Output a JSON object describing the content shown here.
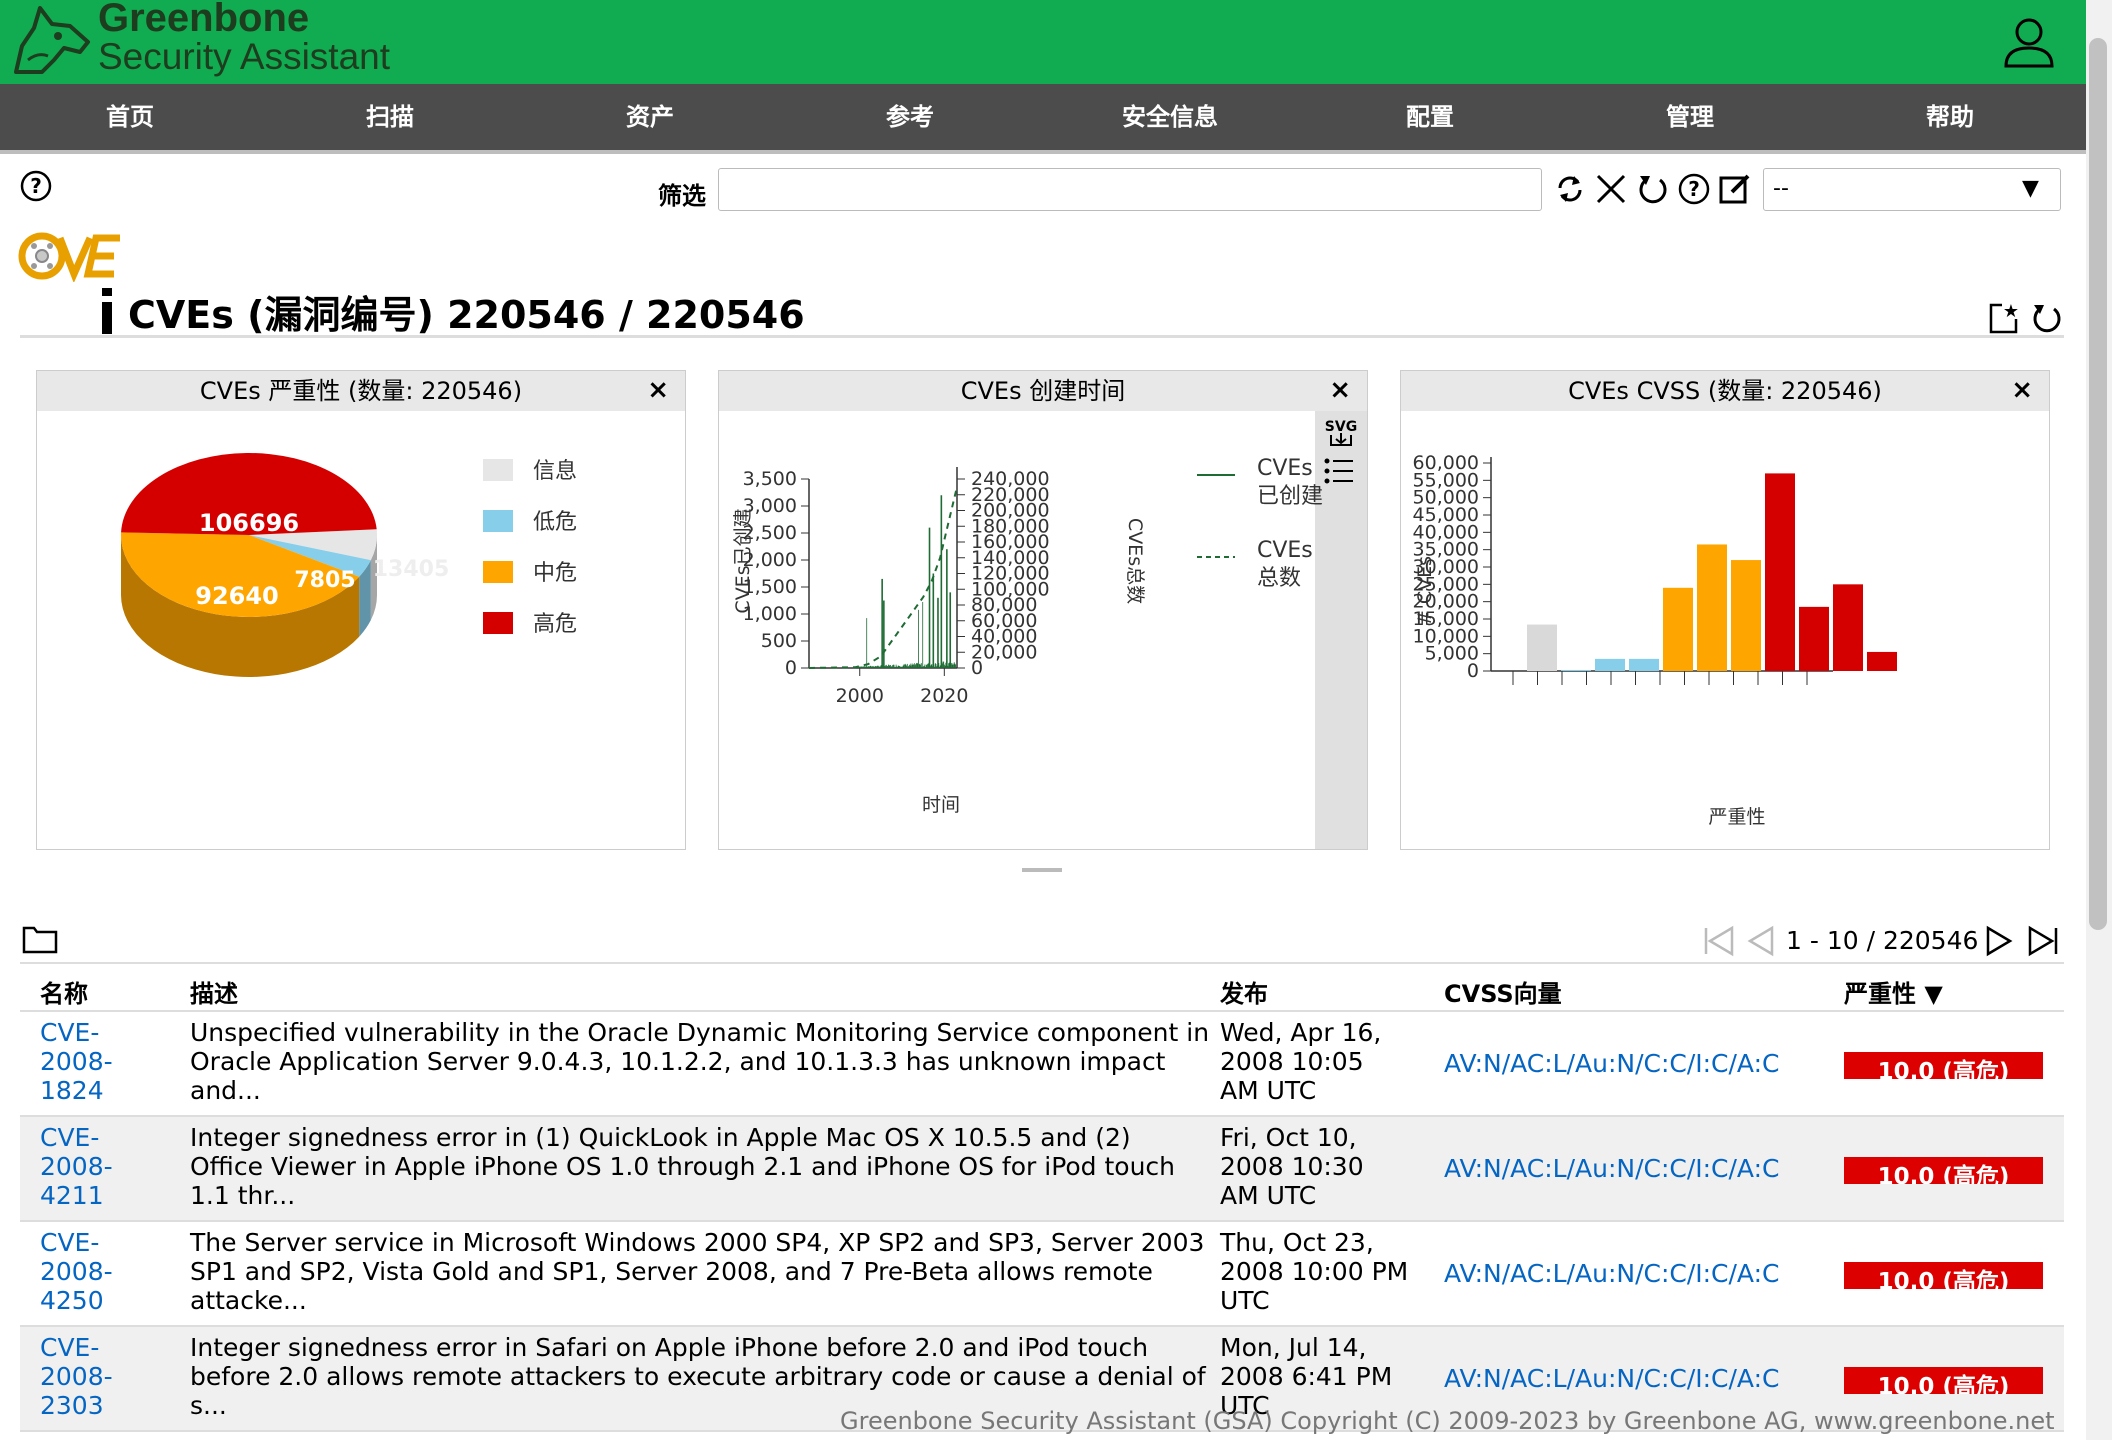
{
  "header": {
    "brand_line1": "Greenbone",
    "brand_line2": "Security Assistant"
  },
  "nav": [
    "首页",
    "扫描",
    "资产",
    "参考",
    "安全信息",
    "配置",
    "管理",
    "帮助"
  ],
  "filter": {
    "label": "筛选",
    "value": "",
    "select_value": "--"
  },
  "page": {
    "title": "CVEs (漏洞编号) 220546 / 220546"
  },
  "panels": {
    "severity": {
      "title": "CVEs 严重性 (数量: 220546)",
      "legend": [
        "信息",
        "低危",
        "中危",
        "高危"
      ],
      "labels": [
        "106696",
        "92640",
        "7805",
        "13405"
      ],
      "values": [
        {
          "label": "信息",
          "count": 13405
        },
        {
          "label": "低危",
          "count": 7805
        },
        {
          "label": "中危",
          "count": 92640
        },
        {
          "label": "高危",
          "count": 106696
        }
      ]
    },
    "created": {
      "title": "CVEs 创建时间",
      "ylabel_left": "CVEs已创建",
      "ylabel_right": "CVEs总数",
      "xlabel": "时间",
      "legend": [
        "CVEs已创建",
        "CVEs总数"
      ],
      "legend_line1": [
        "CVEs",
        "CVEs"
      ],
      "legend_line2": [
        "已创建",
        "总数"
      ],
      "svg_label": "SVG"
    },
    "cvss": {
      "title": "CVEs CVSS (数量: 220546)",
      "ylabel": "# CVEs",
      "xlabel": "严重性"
    }
  },
  "table": {
    "columns": [
      "名称",
      "描述",
      "发布",
      "CVSS向量",
      "严重性 ▼"
    ],
    "pager": "1 - 10 / 220546",
    "rows": [
      {
        "name": "CVE-2008-1824",
        "name_l1": "CVE-",
        "name_l2": "2008-",
        "name_l3": "1824",
        "desc_l1": "Unspecified vulnerability in the Oracle Dynamic Monitoring Service component in",
        "desc_l2": "Oracle Application Server 9.0.4.3, 10.1.2.2, and 10.1.3.3 has unknown impact",
        "desc_l3": "and...",
        "pub_l1": "Wed, Apr 16,",
        "pub_l2": "2008 10:05",
        "pub_l3": "AM UTC",
        "vector": "AV:N/AC:L/Au:N/C:C/I:C/A:C",
        "severity": "10.0 (高危)"
      },
      {
        "name": "CVE-2008-4211",
        "name_l1": "CVE-",
        "name_l2": "2008-",
        "name_l3": "4211",
        "desc_l1": "Integer signedness error in (1) QuickLook in Apple Mac OS X 10.5.5 and (2)",
        "desc_l2": "Office Viewer in Apple iPhone OS 1.0 through 2.1 and iPhone OS for iPod touch",
        "desc_l3": "1.1 thr...",
        "pub_l1": "Fri, Oct 10,",
        "pub_l2": "2008 10:30",
        "pub_l3": "AM UTC",
        "vector": "AV:N/AC:L/Au:N/C:C/I:C/A:C",
        "severity": "10.0 (高危)"
      },
      {
        "name": "CVE-2008-4250",
        "name_l1": "CVE-",
        "name_l2": "2008-",
        "name_l3": "4250",
        "desc_l1": "The Server service in Microsoft Windows 2000 SP4, XP SP2 and SP3, Server 2003",
        "desc_l2": "SP1 and SP2, Vista Gold and SP1, Server 2008, and 7 Pre-Beta allows remote",
        "desc_l3": "attacke...",
        "pub_l1": "Thu, Oct 23,",
        "pub_l2": "2008 10:00 PM",
        "pub_l3": "UTC",
        "vector": "AV:N/AC:L/Au:N/C:C/I:C/A:C",
        "severity": "10.0 (高危)"
      },
      {
        "name": "CVE-2008-2303",
        "name_l1": "CVE-",
        "name_l2": "2008-",
        "name_l3": "2303",
        "desc_l1": "Integer signedness error in Safari on Apple iPhone before 2.0 and iPod touch",
        "desc_l2": "before 2.0 allows remote attackers to execute arbitrary code or cause a denial of",
        "desc_l3": "s...",
        "pub_l1": "Mon, Jul 14,",
        "pub_l2": "2008 6:41 PM",
        "pub_l3": "UTC",
        "vector": "AV:N/AC:L/Au:N/C:C/I:C/A:C",
        "severity": "10.0 (高危)"
      }
    ]
  },
  "footer": "Greenbone Security Assistant (GSA) Copyright (C) 2009-2023 by Greenbone AG, www.greenbone.net",
  "chart_data": [
    {
      "type": "pie",
      "title": "CVEs 严重性 (数量: 220546)",
      "categories": [
        "信息",
        "低危",
        "中危",
        "高危"
      ],
      "values": [
        13405,
        7805,
        92640,
        106696
      ],
      "colors": [
        "#e6e6e6",
        "#87ceeb",
        "#ffa500",
        "#d40000"
      ]
    },
    {
      "type": "line",
      "title": "CVEs 创建时间",
      "xlabel": "时间",
      "series": [
        {
          "name": "CVEs已创建",
          "axis": "left",
          "ylim": [
            0,
            3500
          ]
        },
        {
          "name": "CVEs总数",
          "axis": "right",
          "ylim": [
            0,
            240000
          ]
        }
      ],
      "xticks": [
        2000,
        2020
      ],
      "yticks_left": [
        0,
        500,
        1000,
        1500,
        2000,
        2500,
        3000,
        3500
      ],
      "yticks_right": [
        0,
        20000,
        40000,
        60000,
        80000,
        100000,
        120000,
        140000,
        160000,
        180000,
        200000,
        220000,
        240000
      ],
      "x_points": [
        1988,
        1999,
        2002,
        2005,
        2007,
        2009,
        2011,
        2013,
        2015,
        2017,
        2019,
        2021,
        2023
      ],
      "total_values": [
        0,
        1000,
        5000,
        15000,
        30000,
        45000,
        60000,
        75000,
        90000,
        110000,
        140000,
        185000,
        230000
      ]
    },
    {
      "type": "bar",
      "title": "CVEs CVSS (数量: 220546)",
      "xlabel": "严重性",
      "ylabel": "# CVEs",
      "ylim": [
        0,
        60000
      ],
      "yticks": [
        0,
        5000,
        10000,
        15000,
        20000,
        25000,
        30000,
        35000,
        40000,
        45000,
        50000,
        55000,
        60000
      ],
      "values": [
        13400,
        300,
        3500,
        3500,
        24000,
        36500,
        32000,
        57000,
        18500,
        25000,
        5500
      ],
      "colors": [
        "#d9d9d9",
        "#87ceeb",
        "#87ceeb",
        "#87ceeb",
        "#ffa500",
        "#ffa500",
        "#ffa500",
        "#d40000",
        "#d40000",
        "#d40000",
        "#d40000"
      ]
    }
  ]
}
